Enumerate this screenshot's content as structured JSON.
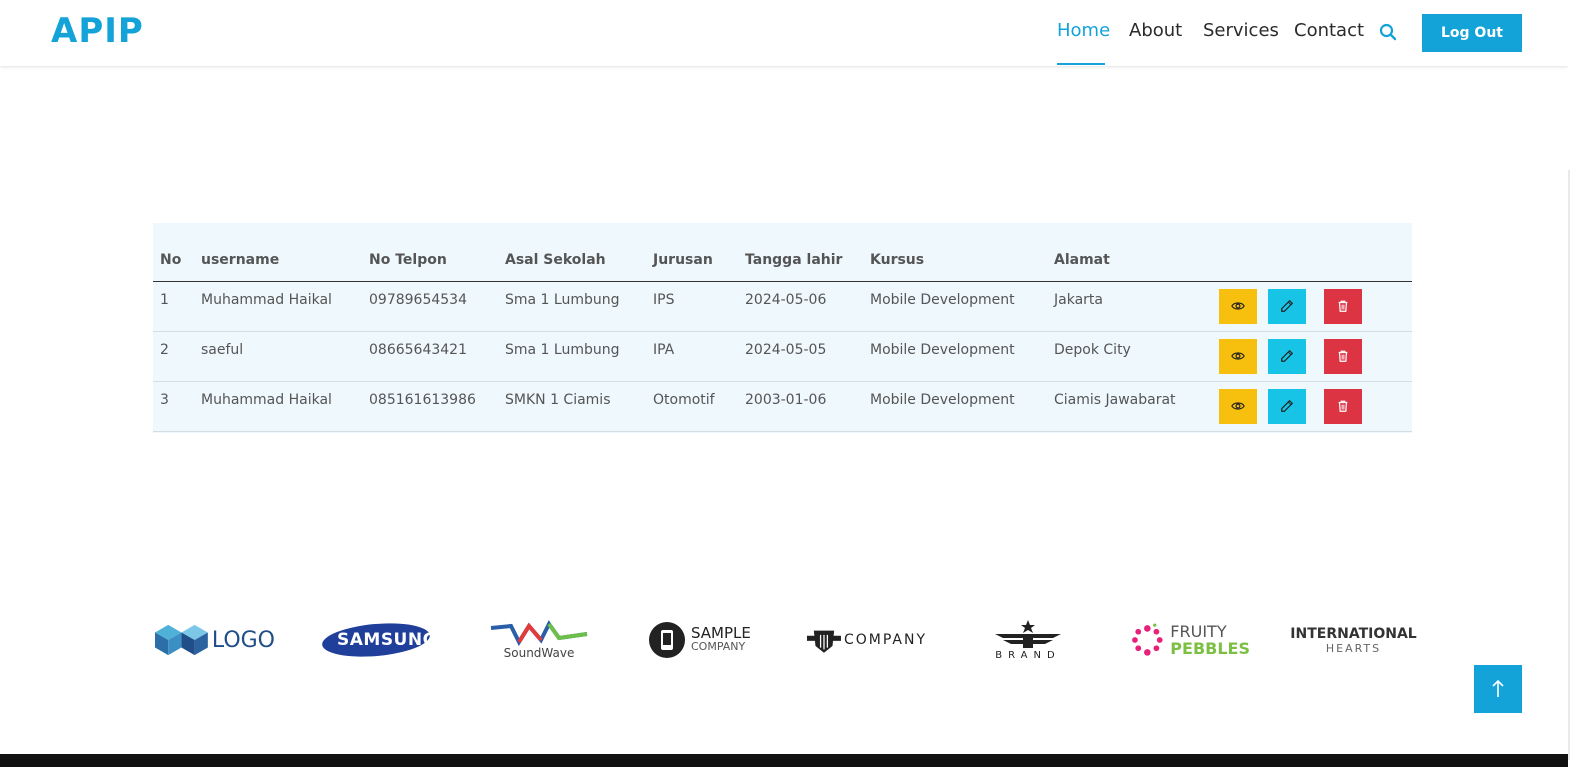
{
  "header": {
    "logo": "APIP",
    "nav": [
      {
        "label": "Home",
        "active": true
      },
      {
        "label": "About",
        "active": false
      },
      {
        "label": "Services",
        "active": false
      },
      {
        "label": "Contact",
        "active": false
      }
    ],
    "search_icon": "search-icon",
    "logout_label": "Log Out"
  },
  "table": {
    "headers": [
      "No",
      "username",
      "No Telpon",
      "Asal Sekolah",
      "Jurusan",
      "Tangga lahir",
      "Kursus",
      "Alamat"
    ],
    "rows": [
      [
        "1",
        "Muhammad Haikal",
        "09789654534",
        "Sma 1 Lumbung",
        "IPS",
        "2024-05-06",
        "Mobile Development",
        "Jakarta"
      ],
      [
        "2",
        "saeful",
        "08665643421",
        "Sma 1 Lumbung",
        "IPA",
        "2024-05-05",
        "Mobile Development",
        "Depok City"
      ],
      [
        "3",
        "Muhammad Haikal",
        "085161613986",
        "SMKN 1 Ciamis",
        "Otomotif",
        "2003-01-06",
        "Mobile Development",
        "Ciamis Jawabarat"
      ]
    ],
    "action_icons": [
      "eye-icon",
      "pencil-icon",
      "trash-icon"
    ]
  },
  "brands": {
    "logo": "LOGO",
    "samsung": "SAMSUNG",
    "soundwave": "SoundWave",
    "sample_top": "SAMPLE",
    "sample_bottom": "COMPANY",
    "company": "COMPANY",
    "brand": "BRAND",
    "fruity_top": "FRUITY",
    "fruity_bottom": "PEBBLES",
    "intl_top": "INTERNATIONAL",
    "intl_bottom": "HEARTS"
  },
  "colors": {
    "accent": "#14a3d8",
    "view": "#f8c00e",
    "edit": "#18c4e6",
    "delete": "#dd3444"
  },
  "scroll_top_icon": "arrow-up-icon"
}
